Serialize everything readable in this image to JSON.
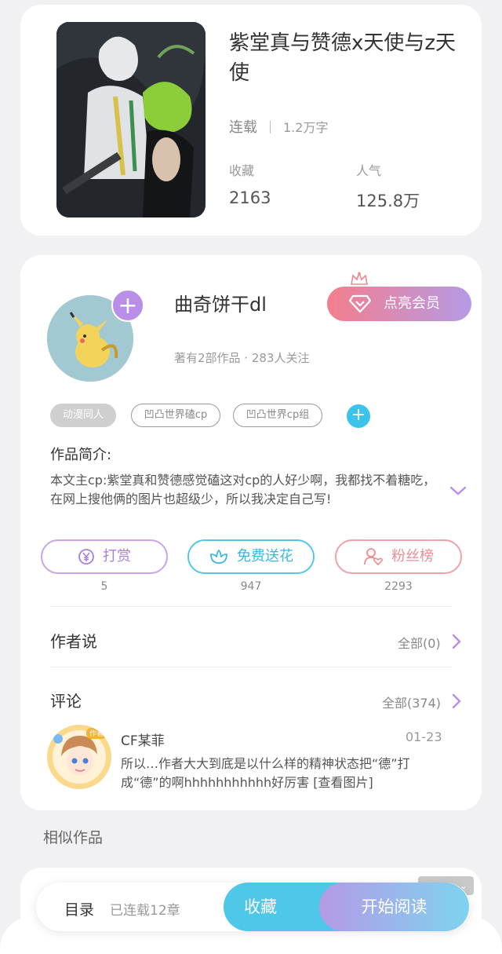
{
  "book": {
    "title": "紫堂真与赞德x天使与z天使",
    "status": "连载",
    "word_count": "1.2万字",
    "favorites_label": "收藏",
    "favorites_value": "2163",
    "popularity_label": "人气",
    "popularity_value": "125.8万"
  },
  "author": {
    "name": "曲奇饼干dl",
    "meta": "著有2部作品 · 283人关注",
    "vip_label": "点亮会员",
    "tags": [
      "动漫同人",
      "凹凸世界磕cp",
      "凹凸世界cp组"
    ],
    "intro_label": "作品简介:",
    "intro_text": "本文主cp:紫堂真和赞德感觉磕这对cp的人好少啊，我都找不着糖吃，在网上搜他俩的图片也超级少，所以我决定自己写!"
  },
  "actions": {
    "reward_label": "打赏",
    "reward_count": "5",
    "flower_label": "免费送花",
    "flower_count": "947",
    "fans_label": "粉丝榜",
    "fans_count": "2293"
  },
  "author_says": {
    "title": "作者说",
    "more": "全部(0)"
  },
  "comments": {
    "title": "评论",
    "more": "全部(374)",
    "items": [
      {
        "user": "CF某菲",
        "date": "01-23",
        "text": "所以…作者大大到底是以什么样的精神状态把“德”打成“德”的啊hhhhhhhhhhh好厉害 [查看图片]",
        "avatar_badge": "作者"
      }
    ]
  },
  "similar": {
    "title": "相似作品"
  },
  "bottom_bar": {
    "toc_label": "目录",
    "toc_status": "已连载12章",
    "collect_label": "收藏",
    "read_label": "开始阅读"
  },
  "colors": {
    "accent_purple": "#b98ee8",
    "accent_cyan": "#4fc7e8",
    "accent_pink": "#f47e8d"
  }
}
